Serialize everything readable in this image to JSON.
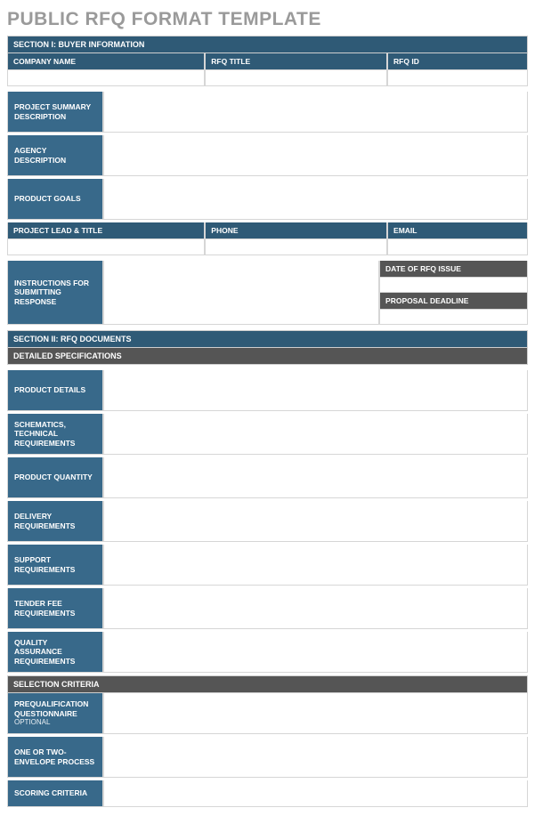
{
  "doc_title": "PUBLIC RFQ FORMAT TEMPLATE",
  "section1": {
    "title": "SECTION I:  BUYER INFORMATION",
    "headers": {
      "company": "COMPANY NAME",
      "rfq_title": "RFQ TITLE",
      "rfq_id": "RFQ ID"
    },
    "rows": {
      "project_summary": "PROJECT SUMMARY DESCRIPTION",
      "agency_desc": "AGENCY DESCRIPTION",
      "product_goals": "PRODUCT GOALS"
    },
    "lead_headers": {
      "lead": "PROJECT LEAD & TITLE",
      "phone": "PHONE",
      "email": "EMAIL"
    },
    "instructions": "INSTRUCTIONS FOR SUBMITTING RESPONSE",
    "date_issue": "DATE OF RFQ ISSUE",
    "deadline": "PROPOSAL DEADLINE"
  },
  "section2": {
    "title": "SECTION II:  RFQ DOCUMENTS",
    "spec_header": "DETAILED SPECIFICATIONS",
    "rows": {
      "product_details": "PRODUCT DETAILS",
      "schematics": "SCHEMATICS, TECHNICAL REQUIREMENTS",
      "quantity": "PRODUCT QUANTITY",
      "delivery": "DELIVERY REQUIREMENTS",
      "support": "SUPPORT REQUIREMENTS",
      "tender_fee": "TENDER FEE REQUIREMENTS",
      "qa": "QUALITY ASSURANCE REQUIREMENTS"
    },
    "selection_header": "SELECTION CRITERIA",
    "selection_rows": {
      "prequal": "PREQUALIFICATION QUESTIONNAIRE",
      "prequal_note": "OPTIONAL",
      "envelope": "ONE OR TWO-ENVELOPE PROCESS",
      "scoring": "SCORING CRITERIA"
    }
  }
}
